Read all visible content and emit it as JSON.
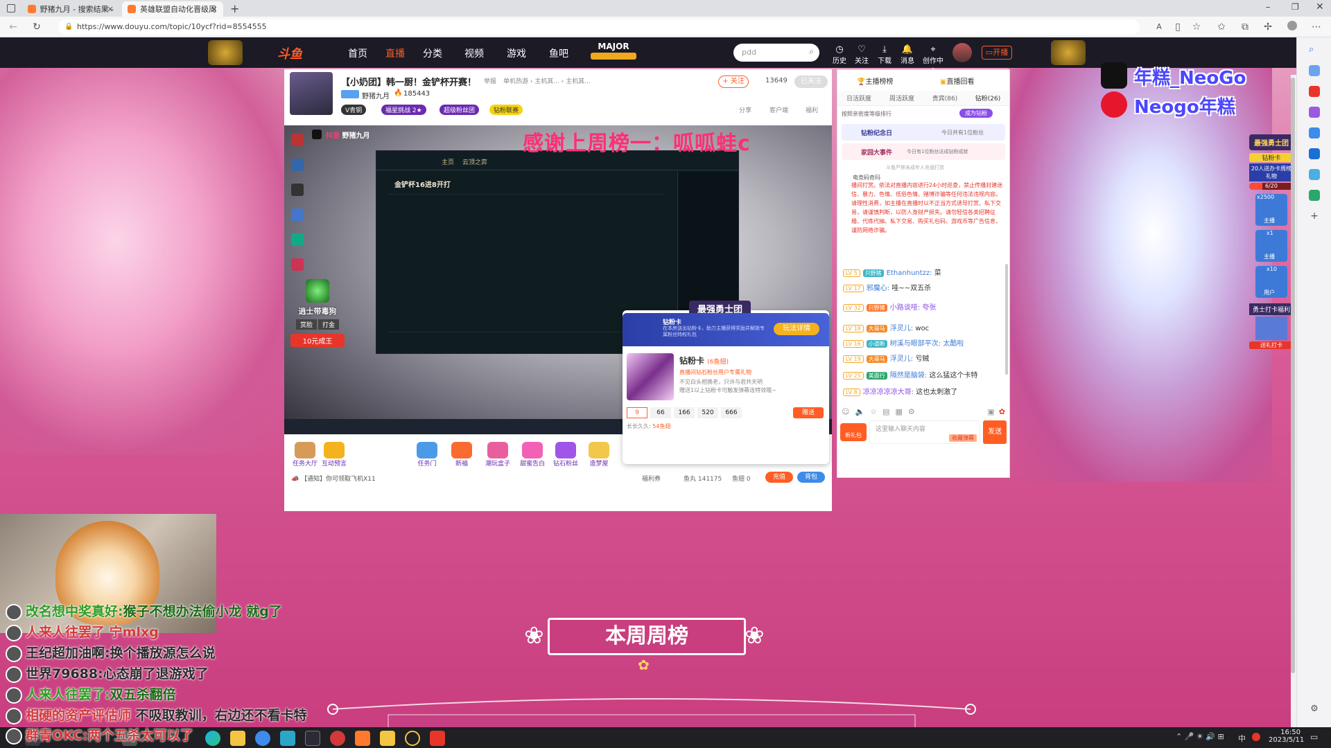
{
  "browser": {
    "tabs": [
      {
        "title": "野猪九月 - 搜索结果 - 斗鱼直播"
      },
      {
        "title": "英雄联盟自动化晋级周榜",
        "active": true
      }
    ],
    "url": "https://www.douyu.com/topic/10ycf?rid=8554555"
  },
  "site": {
    "logo": "斗鱼",
    "nav": [
      "首页",
      "直播",
      "分类",
      "视频",
      "游戏",
      "鱼吧"
    ],
    "major_logo": "MAJOR",
    "search_placeholder": "pdd",
    "top_icons": [
      "历史",
      "关注",
      "下载",
      "消息",
      "创作中心"
    ],
    "live_button": "开播"
  },
  "room": {
    "title": "【小奶团】韩一厨！金铲杯开赛！",
    "tag": "举报",
    "category": "单机热游 › 主机其... › 主机其...",
    "streamer": "野猪九月",
    "heat": "185443",
    "follow_button": "+ 关注",
    "follower_count": "13649",
    "follow_state": "已关注",
    "rank_badge": "V青铜",
    "level_badge": "福星挑战 2★",
    "fan_badge": "超级粉丝团",
    "diamond_badge": "钻粉联赛",
    "share": "分享",
    "client": "客户端",
    "welfare": "福利"
  },
  "video": {
    "overlay_thanks": "感谢上周榜一：呱呱蛙c",
    "douyin_title": "野猪九月",
    "game_title": "金铲杯16进8开打",
    "client_tabs": [
      "主页",
      "云顶之弈"
    ],
    "mini_gift_label": "逍士带毒狗",
    "mini_gift_buttons": [
      "赏脸",
      "打金"
    ],
    "mini_gift_price": "10元成王"
  },
  "gift_bar": {
    "gifts": [
      "任务大厅",
      "互动预言",
      "任务门",
      "新福",
      "潮玩盒子",
      "甜蜜告白",
      "钻石粉丝",
      "造梦屋"
    ],
    "notice": "【通知】你可领取飞机X11",
    "welfare": "福利券",
    "fish_balls": "鱼丸 141175",
    "fish_wings": "鱼翅 0",
    "recharge": "充值",
    "backpack": "背包"
  },
  "popup": {
    "banner_title": "最强勇士团",
    "card_label": "钻粉卡",
    "card_desc": "在本房送出钻粉卡，助力主播获得奖励并解锁专属粉丝特权礼包",
    "detail_button": "玩法详情",
    "card_name": "钻粉卡",
    "card_price": "(6鱼翅)",
    "card_sub": "直播间钻石粉丝用户专属礼物",
    "card_info": "不见白头相携老，只许与君共天明",
    "card_note": "赠送1以上钻粉卡可触发弹幕连特效哦~",
    "quantities": [
      "9",
      "66",
      "166",
      "520",
      "666"
    ],
    "send_button": "赠送",
    "duration_label": "长长久久:",
    "duration_value": "54鱼翅"
  },
  "chat": {
    "tabs": [
      "主播榜榜",
      "直播回看"
    ],
    "sub_tabs": [
      "日活跃度",
      "周活跃度",
      "贵宾(86)",
      "钻粉(26)"
    ],
    "rank_note": "按照亲密度等级排行",
    "become_diamond": "成为钻粉",
    "commemorate": "钻粉纪念日",
    "commemorate_note": "今日共有1位粉丝",
    "event": "家园大事件",
    "event_note": "今日有1位粉丝达成钻粉成就",
    "system_note": "斗鱼严禁未成年人充值打赏",
    "announcement_user": "电竞码奇玛",
    "announcement": "播间打赏。依法对直播内容进行24小时巡查，禁止传播封建迷信、暴力、色情、低俗色情、赌博诈骗等任何违法违规内容。请理性消费，如主播在直播时以不正当方式诱导打赏、私下交易，请谨慎判断，以防人身财产损失。请勿轻信各类招聘征婚、代练代抽、私下交易、购买礼包码、游戏币等广告信息，谨防网络诈骗。",
    "messages": [
      {
        "lv": "LV 5",
        "badge": "只野猪",
        "user": "Ethanhuntzz:",
        "text": "菜"
      },
      {
        "lv": "LV 17",
        "badge": "",
        "user": "邪魔心:",
        "text": "哇~~双五杀"
      },
      {
        "lv": "LV 32",
        "badge": "只野猪",
        "user": "小路谈哑:",
        "text": "夸张"
      },
      {
        "lv": "LV 18",
        "badge": "大哥马",
        "user": "浮灵儿:",
        "text": "woc"
      },
      {
        "lv": "LV 16",
        "badge": "小道断",
        "user": "树溪与眼部平次:",
        "text": "太酷啦"
      },
      {
        "lv": "LV 19",
        "badge": "大哥马",
        "user": "浮灵儿:",
        "text": "亏贼"
      },
      {
        "lv": "LV 25",
        "badge": "美面行",
        "user": "隔然是脑袋:",
        "text": "这么猛这个卡特"
      },
      {
        "lv": "LV 8",
        "badge": "",
        "user": "凉凉凉凉凉大哥:",
        "text": "这也太刺激了"
      }
    ],
    "input_placeholder": "这里输入聊天内容",
    "send_button": "发送",
    "barrage_button": "收藏弹幕",
    "new_gift": "新礼包"
  },
  "overlay_chat": [
    {
      "user": "改名想中奖真好:",
      "text": "猴子不想办法偷小龙  就g了",
      "user_color": "#2e9e24",
      "text_color": "#1a6a14"
    },
    {
      "user": "人来人往罢了",
      "text": "宁mlxg",
      "user_color": "#d23a3a",
      "text_color": "#d23a3a"
    },
    {
      "user": "王纪超加油啊:",
      "text": "换个播放源怎么说",
      "user_color": "#2a2a2a",
      "text_color": "#2a2a2a"
    },
    {
      "user": "世界79688:",
      "text": "心态崩了退游戏了",
      "user_color": "#2a2a2a",
      "text_color": "#2a2a2a"
    },
    {
      "user": "人来人往罢了:",
      "text": "双五杀翻倍",
      "user_color": "#2e9e24",
      "text_color": "#1a6a14"
    },
    {
      "user": "相硬的资产评估师",
      "text": "不吸取教训，右边还不看卡特",
      "user_color": "#d23a3a",
      "text_color": "#2a2a2a"
    },
    {
      "user": "群青OKC:",
      "text": "两个五杀太可以了",
      "user_color": "#d23a3a",
      "text_color": "#d23a3a"
    }
  ],
  "weekly_title": "本周周榜",
  "social": {
    "douyin": "年糕_NeoGo",
    "weibo": "Neogo年糕"
  },
  "side_widget": {
    "title": "最强勇士团",
    "card": "钻粉卡",
    "reward": "20人送办卡周榜礼物",
    "progress": "6/20",
    "progress_value": 0.3,
    "badges": [
      "主播",
      "主播",
      "用户"
    ],
    "counts": [
      "x2500",
      "x1",
      "x10"
    ],
    "welfare": "勇士打卡福利",
    "welfare_button": "送礼打卡"
  },
  "taskbar": {
    "time": "16:50",
    "date": "2023/5/11",
    "ime": "中"
  },
  "colors": {
    "accent_orange": "#ff5d23",
    "douyu_purple": "#6a2bb0",
    "overlay_pink": "#ff2f74",
    "page_pink": "#d95e9a"
  }
}
